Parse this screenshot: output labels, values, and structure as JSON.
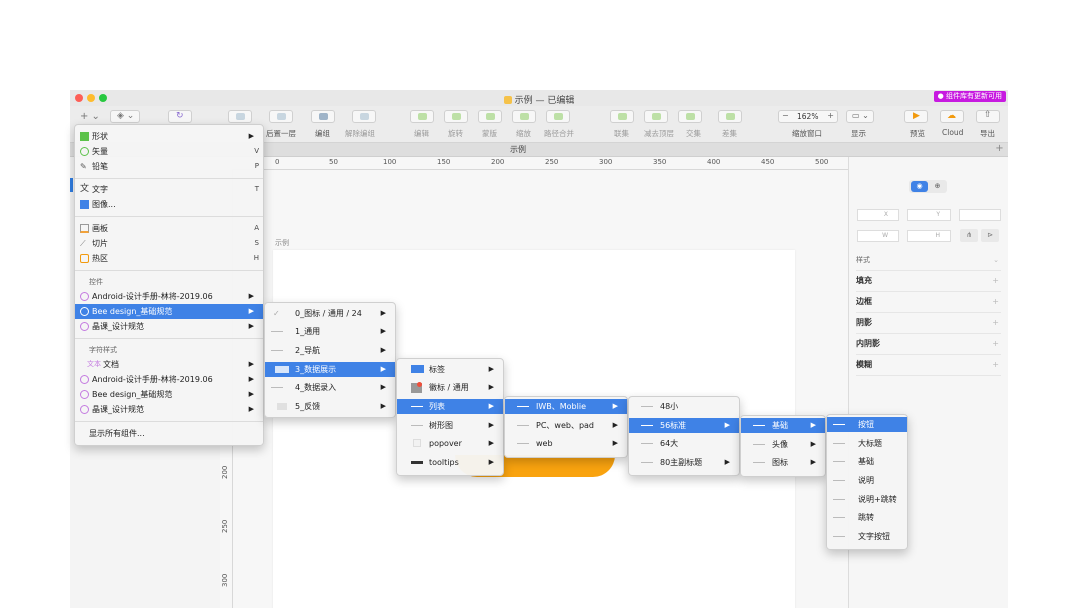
{
  "window": {
    "title": "示例 — 已编辑",
    "badge": "● 组件库有更新可用",
    "tab_title": "示例"
  },
  "toolbar": {
    "labels": {
      "layer_backward": "后置一层",
      "group": "编组",
      "ungroup": "解除编组",
      "edit": "编辑",
      "rotate": "旋转",
      "mask": "蒙版",
      "scale": "缩放",
      "path_combine": "路径合并",
      "union": "联集",
      "subtract": "减去顶层",
      "intersect": "交集",
      "difference": "差集",
      "zoom_window": "缩放窗口",
      "display": "显示",
      "preview": "预览",
      "cloud": "Cloud",
      "export": "导出"
    },
    "zoom": "162%"
  },
  "ruler": {
    "top": [
      "0",
      "50",
      "100",
      "150",
      "200",
      "250",
      "300",
      "350",
      "400",
      "450",
      "500"
    ],
    "left": [
      "200",
      "250",
      "300"
    ]
  },
  "canvas": {
    "artboard_label": "示例"
  },
  "inspector": {
    "fields": {
      "x": "X",
      "y": "Y",
      "w": "W",
      "h": "H"
    },
    "style_label": "样式",
    "rows": [
      "填充",
      "边框",
      "阴影",
      "内阴影",
      "模糊"
    ]
  },
  "insert_menu": {
    "items": [
      {
        "label": "形状",
        "key": "",
        "submenu": true
      },
      {
        "label": "矢量",
        "key": "V"
      },
      {
        "label": "铅笔",
        "key": "P"
      },
      {
        "label": "文字",
        "key": "T"
      },
      {
        "label": "图像...",
        "key": ""
      },
      {
        "label": "画板",
        "key": "A"
      },
      {
        "label": "切片",
        "key": "S"
      },
      {
        "label": "热区",
        "key": "H"
      }
    ],
    "section_symbols": "控件",
    "symbol_libs": [
      "Android-设计手册-林将-2019.06",
      "Bee design_基础规范",
      "晶课_设计规范"
    ],
    "section_text_styles": "字符样式",
    "text_style_libs": [
      "文档",
      "Android-设计手册-林将-2019.06",
      "Bee design_基础规范",
      "晶课_设计规范"
    ],
    "text_style_prefix": "文本",
    "show_all": "显示所有组件..."
  },
  "submenu_bee": {
    "items": [
      "0_图标 / 通用 / 24",
      "1_通用",
      "2_导航",
      "3_数据展示",
      "4_数据录入",
      "5_反馈"
    ]
  },
  "submenu_data_display": {
    "items": [
      "标签",
      "徽标 / 通用",
      "列表",
      "树形图",
      "popover",
      "tooltips"
    ]
  },
  "submenu_list": {
    "items": [
      "IWB、Moblie",
      "PC、web、pad",
      "web"
    ]
  },
  "submenu_iwb": {
    "items": [
      "48小",
      "56标准",
      "64大",
      "80主副标题"
    ]
  },
  "submenu_56": {
    "items": [
      "基础",
      "头像",
      "图标"
    ]
  },
  "submenu_basic": {
    "items": [
      "按钮",
      "大标题",
      "基础",
      "说明",
      "说明+跳转",
      "跳转",
      "文字按钮"
    ]
  }
}
